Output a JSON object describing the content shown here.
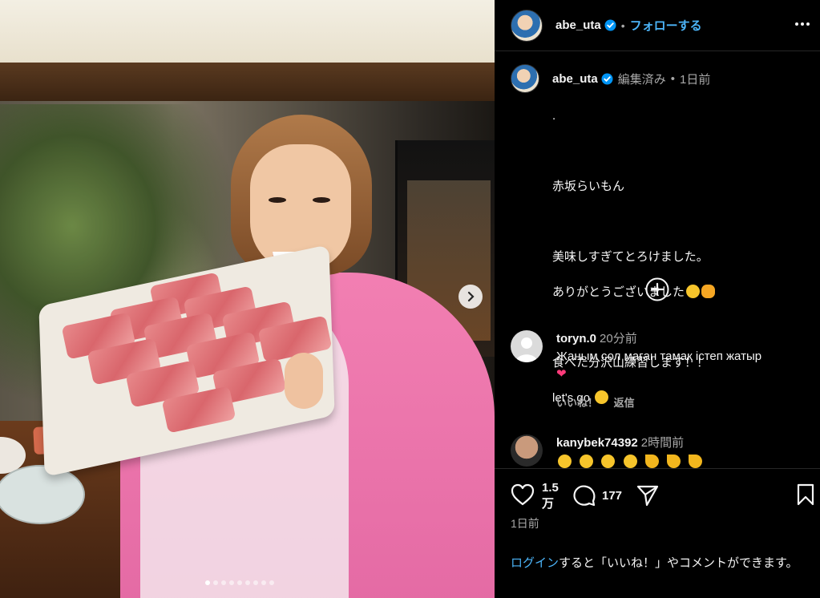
{
  "post": {
    "username": "abe_uta",
    "follow_label": "フォローする",
    "separator": "•",
    "edited_label": "編集済み",
    "time_ago": "1日前",
    "caption_lines": [
      ".",
      "",
      "赤坂らいもん",
      "",
      "美味しすぎてとろけました。",
      "ありがとうございました",
      "",
      "食べた分沢山練習します！！",
      "let's go"
    ],
    "image_dots_count": 9,
    "active_dot_index": 0
  },
  "comments": [
    {
      "username": "toryn.0",
      "time": "20分前",
      "text": "Жаным сол маған тамақ істеп жатыр",
      "like_label": "いいね！",
      "reply_label": "返信"
    },
    {
      "username": "kanybek74392",
      "time": "2時間前",
      "text": ""
    }
  ],
  "stats": {
    "likes_line1": "1.5",
    "likes_line2": "万",
    "comments_count": "177",
    "date": "1日前"
  },
  "login_prompt": {
    "link": "ログイン",
    "rest": "すると「いいね！」やコメントができます。"
  },
  "colors": {
    "accent_blue": "#4cb5f9",
    "background": "#000000",
    "secondary_text": "#a8a8a8"
  },
  "icons": {
    "verified": "verified-badge-icon",
    "more": "more-horizontal-icon",
    "next": "chevron-right-icon",
    "add": "plus-circle-icon",
    "like": "heart-icon",
    "comment": "comment-icon",
    "share": "paper-plane-icon",
    "save": "bookmark-icon"
  }
}
